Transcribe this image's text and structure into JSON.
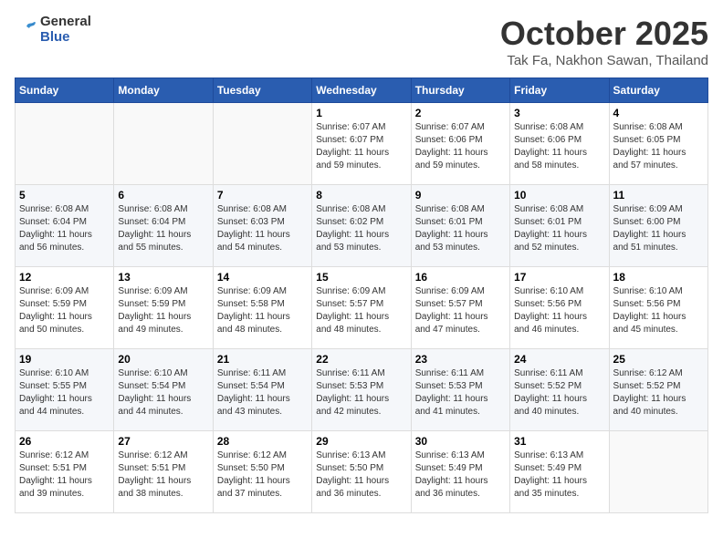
{
  "header": {
    "logo_line1": "General",
    "logo_line2": "Blue",
    "month": "October 2025",
    "location": "Tak Fa, Nakhon Sawan, Thailand"
  },
  "days_of_week": [
    "Sunday",
    "Monday",
    "Tuesday",
    "Wednesday",
    "Thursday",
    "Friday",
    "Saturday"
  ],
  "weeks": [
    [
      {
        "day": "",
        "info": ""
      },
      {
        "day": "",
        "info": ""
      },
      {
        "day": "",
        "info": ""
      },
      {
        "day": "1",
        "info": "Sunrise: 6:07 AM\nSunset: 6:07 PM\nDaylight: 11 hours\nand 59 minutes."
      },
      {
        "day": "2",
        "info": "Sunrise: 6:07 AM\nSunset: 6:06 PM\nDaylight: 11 hours\nand 59 minutes."
      },
      {
        "day": "3",
        "info": "Sunrise: 6:08 AM\nSunset: 6:06 PM\nDaylight: 11 hours\nand 58 minutes."
      },
      {
        "day": "4",
        "info": "Sunrise: 6:08 AM\nSunset: 6:05 PM\nDaylight: 11 hours\nand 57 minutes."
      }
    ],
    [
      {
        "day": "5",
        "info": "Sunrise: 6:08 AM\nSunset: 6:04 PM\nDaylight: 11 hours\nand 56 minutes."
      },
      {
        "day": "6",
        "info": "Sunrise: 6:08 AM\nSunset: 6:04 PM\nDaylight: 11 hours\nand 55 minutes."
      },
      {
        "day": "7",
        "info": "Sunrise: 6:08 AM\nSunset: 6:03 PM\nDaylight: 11 hours\nand 54 minutes."
      },
      {
        "day": "8",
        "info": "Sunrise: 6:08 AM\nSunset: 6:02 PM\nDaylight: 11 hours\nand 53 minutes."
      },
      {
        "day": "9",
        "info": "Sunrise: 6:08 AM\nSunset: 6:01 PM\nDaylight: 11 hours\nand 53 minutes."
      },
      {
        "day": "10",
        "info": "Sunrise: 6:08 AM\nSunset: 6:01 PM\nDaylight: 11 hours\nand 52 minutes."
      },
      {
        "day": "11",
        "info": "Sunrise: 6:09 AM\nSunset: 6:00 PM\nDaylight: 11 hours\nand 51 minutes."
      }
    ],
    [
      {
        "day": "12",
        "info": "Sunrise: 6:09 AM\nSunset: 5:59 PM\nDaylight: 11 hours\nand 50 minutes."
      },
      {
        "day": "13",
        "info": "Sunrise: 6:09 AM\nSunset: 5:59 PM\nDaylight: 11 hours\nand 49 minutes."
      },
      {
        "day": "14",
        "info": "Sunrise: 6:09 AM\nSunset: 5:58 PM\nDaylight: 11 hours\nand 48 minutes."
      },
      {
        "day": "15",
        "info": "Sunrise: 6:09 AM\nSunset: 5:57 PM\nDaylight: 11 hours\nand 48 minutes."
      },
      {
        "day": "16",
        "info": "Sunrise: 6:09 AM\nSunset: 5:57 PM\nDaylight: 11 hours\nand 47 minutes."
      },
      {
        "day": "17",
        "info": "Sunrise: 6:10 AM\nSunset: 5:56 PM\nDaylight: 11 hours\nand 46 minutes."
      },
      {
        "day": "18",
        "info": "Sunrise: 6:10 AM\nSunset: 5:56 PM\nDaylight: 11 hours\nand 45 minutes."
      }
    ],
    [
      {
        "day": "19",
        "info": "Sunrise: 6:10 AM\nSunset: 5:55 PM\nDaylight: 11 hours\nand 44 minutes."
      },
      {
        "day": "20",
        "info": "Sunrise: 6:10 AM\nSunset: 5:54 PM\nDaylight: 11 hours\nand 44 minutes."
      },
      {
        "day": "21",
        "info": "Sunrise: 6:11 AM\nSunset: 5:54 PM\nDaylight: 11 hours\nand 43 minutes."
      },
      {
        "day": "22",
        "info": "Sunrise: 6:11 AM\nSunset: 5:53 PM\nDaylight: 11 hours\nand 42 minutes."
      },
      {
        "day": "23",
        "info": "Sunrise: 6:11 AM\nSunset: 5:53 PM\nDaylight: 11 hours\nand 41 minutes."
      },
      {
        "day": "24",
        "info": "Sunrise: 6:11 AM\nSunset: 5:52 PM\nDaylight: 11 hours\nand 40 minutes."
      },
      {
        "day": "25",
        "info": "Sunrise: 6:12 AM\nSunset: 5:52 PM\nDaylight: 11 hours\nand 40 minutes."
      }
    ],
    [
      {
        "day": "26",
        "info": "Sunrise: 6:12 AM\nSunset: 5:51 PM\nDaylight: 11 hours\nand 39 minutes."
      },
      {
        "day": "27",
        "info": "Sunrise: 6:12 AM\nSunset: 5:51 PM\nDaylight: 11 hours\nand 38 minutes."
      },
      {
        "day": "28",
        "info": "Sunrise: 6:12 AM\nSunset: 5:50 PM\nDaylight: 11 hours\nand 37 minutes."
      },
      {
        "day": "29",
        "info": "Sunrise: 6:13 AM\nSunset: 5:50 PM\nDaylight: 11 hours\nand 36 minutes."
      },
      {
        "day": "30",
        "info": "Sunrise: 6:13 AM\nSunset: 5:49 PM\nDaylight: 11 hours\nand 36 minutes."
      },
      {
        "day": "31",
        "info": "Sunrise: 6:13 AM\nSunset: 5:49 PM\nDaylight: 11 hours\nand 35 minutes."
      },
      {
        "day": "",
        "info": ""
      }
    ]
  ]
}
